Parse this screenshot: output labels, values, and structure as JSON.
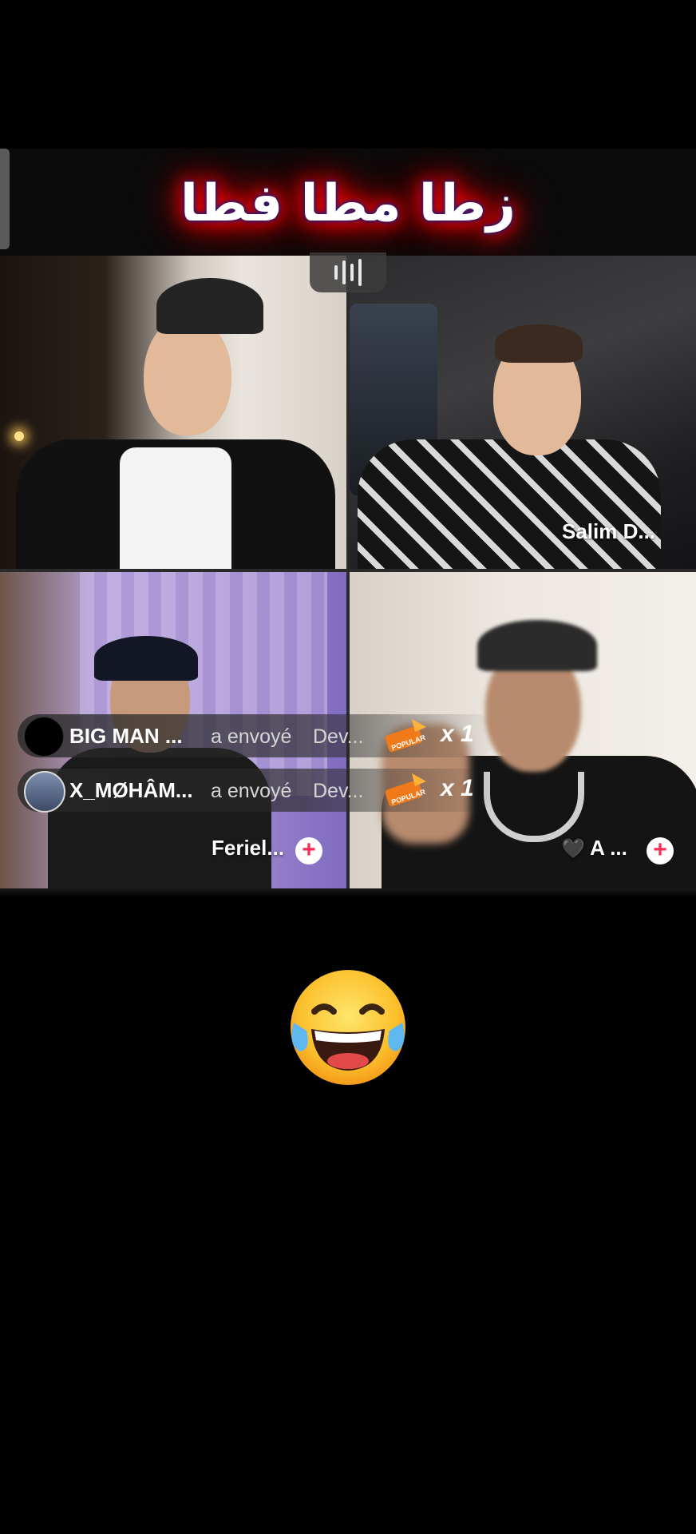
{
  "header": {
    "title": "زطا مطا فطا"
  },
  "participants": [
    {
      "name": ""
    },
    {
      "name": "Salim D..."
    },
    {
      "name": "Feriel...",
      "follow_icon": "+"
    },
    {
      "name": "A ...",
      "badge": "🖤",
      "follow_icon": "+"
    }
  ],
  "gifts": [
    {
      "user": "BIG MAN ...",
      "action": "a envoyé",
      "gift": "Dev...",
      "icon_label": "POPULAR",
      "count": "x 1"
    },
    {
      "user": "X_MØHÂM...",
      "action": "a envoyé",
      "gift": "Dev...",
      "icon_label": "POPULAR",
      "count": "x 1"
    }
  ],
  "icons": {
    "audio": "audio-levels-icon",
    "follow": "plus-icon",
    "gift": "popular-gift-icon",
    "reaction": "laughing-tears-emoji"
  },
  "colors": {
    "title_glow": "#ff0000",
    "follow_accent": "#fe2c55",
    "gift_orange": "#f07a1a"
  }
}
